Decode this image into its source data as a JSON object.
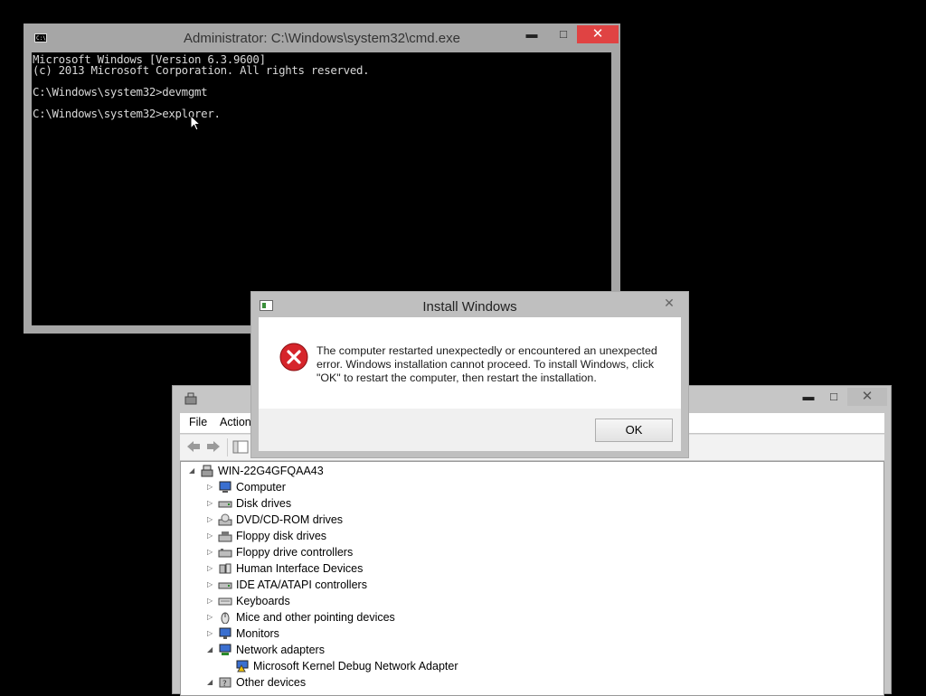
{
  "cmd": {
    "title": "Administrator: C:\\Windows\\system32\\cmd.exe",
    "min": "▬",
    "max": "□",
    "close": "✕",
    "lines": [
      "Microsoft Windows [Version 6.3.9600]",
      "(c) 2013 Microsoft Corporation. All rights reserved.",
      "",
      "C:\\Windows\\system32>devmgmt",
      "",
      "C:\\Windows\\system32>explorer."
    ]
  },
  "devmgr": {
    "min": "▬",
    "max": "□",
    "close": "✕",
    "menu": [
      "File",
      "Action"
    ],
    "tree": {
      "root": "WIN-22G4GFQAA43",
      "items": [
        {
          "label": "Computer",
          "icon": "computer-icon",
          "state": "collapsed"
        },
        {
          "label": "Disk drives",
          "icon": "disk-drive-icon",
          "state": "collapsed"
        },
        {
          "label": "DVD/CD-ROM drives",
          "icon": "dvd-drive-icon",
          "state": "collapsed"
        },
        {
          "label": "Floppy disk drives",
          "icon": "floppy-drive-icon",
          "state": "collapsed"
        },
        {
          "label": "Floppy drive controllers",
          "icon": "floppy-controller-icon",
          "state": "collapsed"
        },
        {
          "label": "Human Interface Devices",
          "icon": "hid-icon",
          "state": "collapsed"
        },
        {
          "label": "IDE ATA/ATAPI controllers",
          "icon": "ide-controller-icon",
          "state": "collapsed"
        },
        {
          "label": "Keyboards",
          "icon": "keyboard-icon",
          "state": "collapsed"
        },
        {
          "label": "Mice and other pointing devices",
          "icon": "mouse-icon",
          "state": "collapsed"
        },
        {
          "label": "Monitors",
          "icon": "monitor-icon",
          "state": "collapsed"
        },
        {
          "label": "Network adapters",
          "icon": "network-adapter-icon",
          "state": "expanded"
        },
        {
          "label": "Microsoft Kernel Debug Network Adapter",
          "icon": "network-adapter-warning-icon",
          "state": "child"
        },
        {
          "label": "Other devices",
          "icon": "other-devices-icon",
          "state": "expanded"
        }
      ]
    }
  },
  "dialog": {
    "title": "Install Windows",
    "close": "✕",
    "message": "The computer restarted unexpectedly or encountered an unexpected error. Windows installation cannot proceed. To install Windows, click \"OK\" to restart the computer, then restart the installation.",
    "ok_label": "OK",
    "error_color": "#d6252b"
  }
}
